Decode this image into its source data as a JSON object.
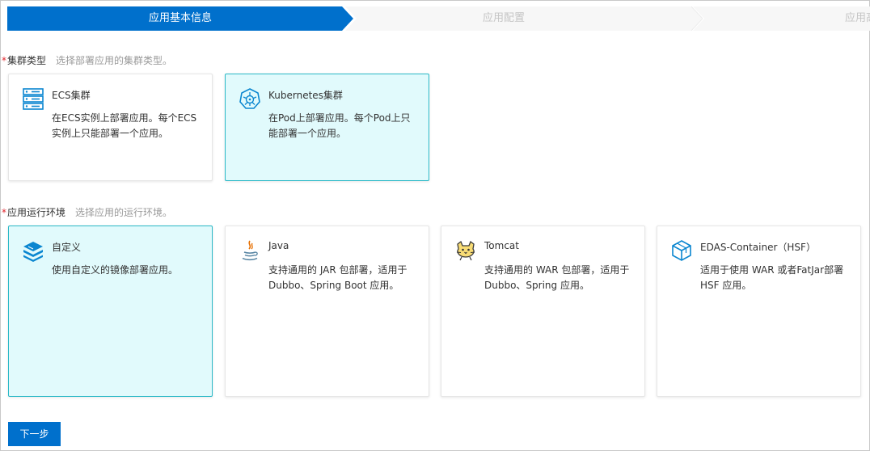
{
  "stepper": {
    "steps": [
      {
        "label": "应用基本信息",
        "state": "active"
      },
      {
        "label": "应用配置",
        "state": "inactive"
      },
      {
        "label": "应用高",
        "state": "inactive"
      }
    ]
  },
  "cluster_section": {
    "required_mark": "*",
    "title": "集群类型",
    "hint": "选择部署应用的集群类型。",
    "cards": [
      {
        "title": "ECS集群",
        "desc": "在ECS实例上部署应用。每个ECS实例上只能部署一个应用。",
        "icon": "server-icon",
        "selected": false
      },
      {
        "title": "Kubernetes集群",
        "desc": "在Pod上部署应用。每个Pod上只能部署一个应用。",
        "icon": "kubernetes-icon",
        "selected": true
      }
    ]
  },
  "runtime_section": {
    "required_mark": "*",
    "title": "应用运行环境",
    "hint": "选择应用的运行环境。",
    "cards": [
      {
        "title": "自定义",
        "desc": "使用自定义的镜像部署应用。",
        "icon": "layers-icon",
        "selected": true
      },
      {
        "title": "Java",
        "desc": "支持通用的 JAR 包部署，适用于 Dubbo、Spring Boot 应用。",
        "icon": "java-icon",
        "selected": false
      },
      {
        "title": "Tomcat",
        "desc": "支持通用的 WAR 包部署，适用于 Dubbo、Spring 应用。",
        "icon": "tomcat-icon",
        "selected": false
      },
      {
        "title": "EDAS-Container（HSF）",
        "desc": "适用于使用 WAR 或者FatJar部署 HSF 应用。",
        "icon": "cube-icon",
        "selected": false
      }
    ]
  },
  "footer": {
    "next_label": "下一步"
  },
  "colors": {
    "primary": "#0070cc",
    "selected_bg": "#e1fafc",
    "selected_border": "#2bb9c7",
    "required": "#e0242b",
    "hint": "#999999"
  }
}
